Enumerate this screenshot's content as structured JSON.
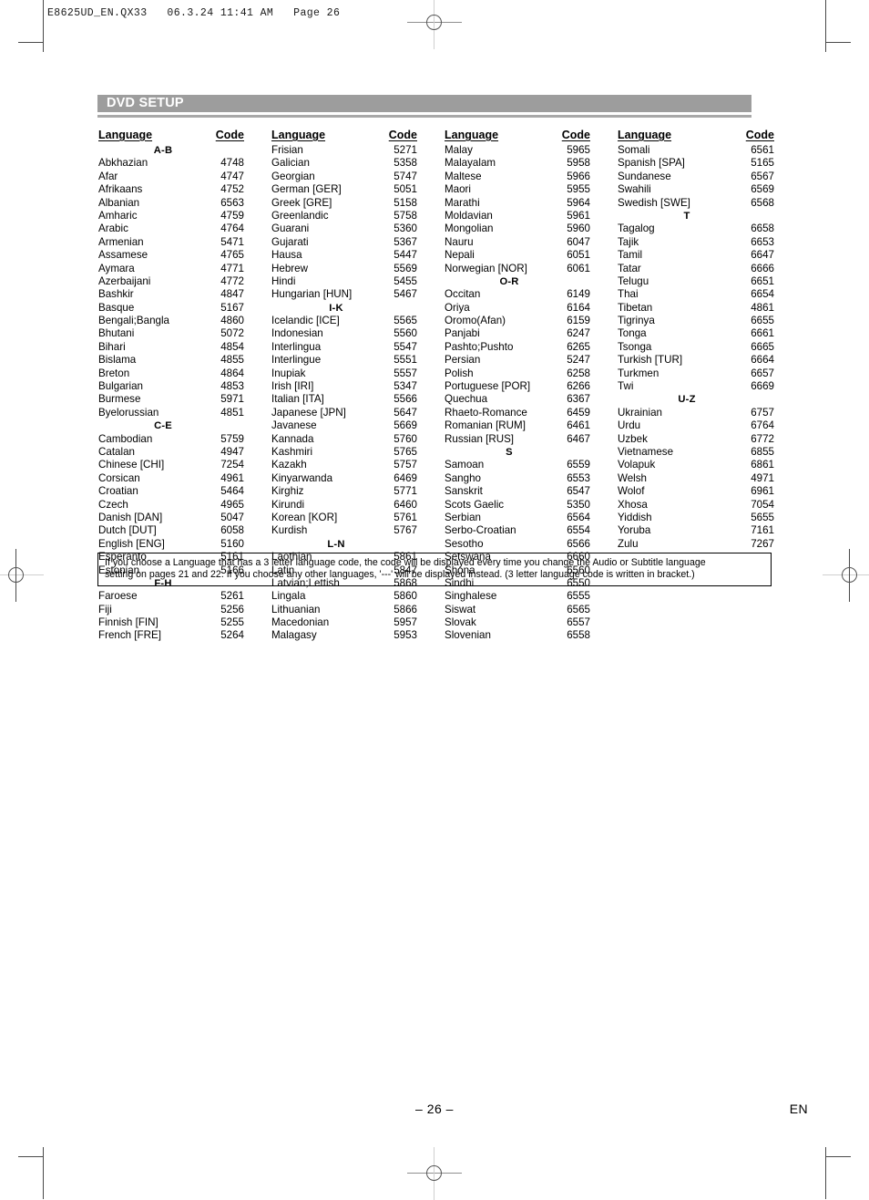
{
  "file_header": "E8625UD_EN.QX33   06.3.24 11:41 AM   Page 26",
  "section": {
    "title": "DVD SETUP",
    "bar_color": "#9d9d9d"
  },
  "table": {
    "header_language": "Language",
    "header_code": "Code",
    "columns": [
      {
        "id": "column-1",
        "rows": [
          {
            "type": "group",
            "label": "A-B"
          },
          {
            "type": "entry",
            "name": "Abkhazian",
            "code": "4748"
          },
          {
            "type": "entry",
            "name": "Afar",
            "code": "4747"
          },
          {
            "type": "entry",
            "name": "Afrikaans",
            "code": "4752"
          },
          {
            "type": "entry",
            "name": "Albanian",
            "code": "6563"
          },
          {
            "type": "entry",
            "name": "Amharic",
            "code": "4759"
          },
          {
            "type": "entry",
            "name": "Arabic",
            "code": "4764"
          },
          {
            "type": "entry",
            "name": "Armenian",
            "code": "5471"
          },
          {
            "type": "entry",
            "name": "Assamese",
            "code": "4765"
          },
          {
            "type": "entry",
            "name": "Aymara",
            "code": "4771"
          },
          {
            "type": "entry",
            "name": "Azerbaijani",
            "code": "4772"
          },
          {
            "type": "entry",
            "name": "Bashkir",
            "code": "4847"
          },
          {
            "type": "entry",
            "name": "Basque",
            "code": "5167"
          },
          {
            "type": "entry",
            "name": "Bengali;Bangla",
            "code": "4860"
          },
          {
            "type": "entry",
            "name": "Bhutani",
            "code": "5072"
          },
          {
            "type": "entry",
            "name": "Bihari",
            "code": "4854"
          },
          {
            "type": "entry",
            "name": "Bislama",
            "code": "4855"
          },
          {
            "type": "entry",
            "name": "Breton",
            "code": "4864"
          },
          {
            "type": "entry",
            "name": "Bulgarian",
            "code": "4853"
          },
          {
            "type": "entry",
            "name": "Burmese",
            "code": "5971"
          },
          {
            "type": "entry",
            "name": "Byelorussian",
            "code": "4851"
          },
          {
            "type": "group",
            "label": "C-E"
          },
          {
            "type": "entry",
            "name": "Cambodian",
            "code": "5759"
          },
          {
            "type": "entry",
            "name": "Catalan",
            "code": "4947"
          },
          {
            "type": "entry",
            "name": "Chinese [CHI]",
            "code": "7254"
          },
          {
            "type": "entry",
            "name": "Corsican",
            "code": "4961"
          },
          {
            "type": "entry",
            "name": "Croatian",
            "code": "5464"
          },
          {
            "type": "entry",
            "name": "Czech",
            "code": "4965"
          },
          {
            "type": "entry",
            "name": "Danish [DAN]",
            "code": "5047"
          },
          {
            "type": "entry",
            "name": "Dutch [DUT]",
            "code": "6058"
          },
          {
            "type": "entry",
            "name": "English [ENG]",
            "code": "5160"
          },
          {
            "type": "entry",
            "name": "Esperanto",
            "code": "5161"
          },
          {
            "type": "entry",
            "name": "Estonian",
            "code": "5166"
          },
          {
            "type": "group",
            "label": "F-H"
          },
          {
            "type": "entry",
            "name": "Faroese",
            "code": "5261"
          },
          {
            "type": "entry",
            "name": "Fiji",
            "code": "5256"
          },
          {
            "type": "entry",
            "name": "Finnish [FIN]",
            "code": "5255"
          },
          {
            "type": "entry",
            "name": "French [FRE]",
            "code": "5264"
          }
        ]
      },
      {
        "id": "column-2",
        "rows": [
          {
            "type": "entry",
            "name": "Frisian",
            "code": "5271"
          },
          {
            "type": "entry",
            "name": "Galician",
            "code": "5358"
          },
          {
            "type": "entry",
            "name": "Georgian",
            "code": "5747"
          },
          {
            "type": "entry",
            "name": "German [GER]",
            "code": "5051"
          },
          {
            "type": "entry",
            "name": "Greek [GRE]",
            "code": "5158"
          },
          {
            "type": "entry",
            "name": "Greenlandic",
            "code": "5758"
          },
          {
            "type": "entry",
            "name": "Guarani",
            "code": "5360"
          },
          {
            "type": "entry",
            "name": "Gujarati",
            "code": "5367"
          },
          {
            "type": "entry",
            "name": "Hausa",
            "code": "5447"
          },
          {
            "type": "entry",
            "name": "Hebrew",
            "code": "5569"
          },
          {
            "type": "entry",
            "name": "Hindi",
            "code": "5455"
          },
          {
            "type": "entry",
            "name": "Hungarian [HUN]",
            "code": "5467"
          },
          {
            "type": "group",
            "label": "I-K"
          },
          {
            "type": "entry",
            "name": "Icelandic [ICE]",
            "code": "5565"
          },
          {
            "type": "entry",
            "name": "Indonesian",
            "code": "5560"
          },
          {
            "type": "entry",
            "name": "Interlingua",
            "code": "5547"
          },
          {
            "type": "entry",
            "name": "Interlingue",
            "code": "5551"
          },
          {
            "type": "entry",
            "name": "Inupiak",
            "code": "5557"
          },
          {
            "type": "entry",
            "name": "Irish [IRI]",
            "code": "5347"
          },
          {
            "type": "entry",
            "name": "Italian [ITA]",
            "code": "5566"
          },
          {
            "type": "entry",
            "name": "Japanese [JPN]",
            "code": "5647"
          },
          {
            "type": "entry",
            "name": "Javanese",
            "code": "5669"
          },
          {
            "type": "entry",
            "name": "Kannada",
            "code": "5760"
          },
          {
            "type": "entry",
            "name": "Kashmiri",
            "code": "5765"
          },
          {
            "type": "entry",
            "name": "Kazakh",
            "code": "5757"
          },
          {
            "type": "entry",
            "name": "Kinyarwanda",
            "code": "6469"
          },
          {
            "type": "entry",
            "name": "Kirghiz",
            "code": "5771"
          },
          {
            "type": "entry",
            "name": "Kirundi",
            "code": "6460"
          },
          {
            "type": "entry",
            "name": "Korean [KOR]",
            "code": "5761"
          },
          {
            "type": "entry",
            "name": "Kurdish",
            "code": "5767"
          },
          {
            "type": "group",
            "label": "L-N"
          },
          {
            "type": "entry",
            "name": "Laothian",
            "code": "5861"
          },
          {
            "type": "entry",
            "name": "Latin",
            "code": "5847"
          },
          {
            "type": "entry",
            "name": "Latvian;Lettish",
            "code": "5868"
          },
          {
            "type": "entry",
            "name": "Lingala",
            "code": "5860"
          },
          {
            "type": "entry",
            "name": "Lithuanian",
            "code": "5866"
          },
          {
            "type": "entry",
            "name": "Macedonian",
            "code": "5957"
          },
          {
            "type": "entry",
            "name": "Malagasy",
            "code": "5953"
          }
        ]
      },
      {
        "id": "column-3",
        "rows": [
          {
            "type": "entry",
            "name": "Malay",
            "code": "5965"
          },
          {
            "type": "entry",
            "name": "Malayalam",
            "code": "5958"
          },
          {
            "type": "entry",
            "name": "Maltese",
            "code": "5966"
          },
          {
            "type": "entry",
            "name": "Maori",
            "code": "5955"
          },
          {
            "type": "entry",
            "name": "Marathi",
            "code": "5964"
          },
          {
            "type": "entry",
            "name": "Moldavian",
            "code": "5961"
          },
          {
            "type": "entry",
            "name": "Mongolian",
            "code": "5960"
          },
          {
            "type": "entry",
            "name": "Nauru",
            "code": "6047"
          },
          {
            "type": "entry",
            "name": "Nepali",
            "code": "6051"
          },
          {
            "type": "entry",
            "name": "Norwegian [NOR]",
            "code": "6061"
          },
          {
            "type": "group",
            "label": "O-R"
          },
          {
            "type": "entry",
            "name": "Occitan",
            "code": "6149"
          },
          {
            "type": "entry",
            "name": "Oriya",
            "code": "6164"
          },
          {
            "type": "entry",
            "name": "Oromo(Afan)",
            "code": "6159"
          },
          {
            "type": "entry",
            "name": "Panjabi",
            "code": "6247"
          },
          {
            "type": "entry",
            "name": "Pashto;Pushto",
            "code": "6265"
          },
          {
            "type": "entry",
            "name": "Persian",
            "code": "5247"
          },
          {
            "type": "entry",
            "name": "Polish",
            "code": "6258"
          },
          {
            "type": "entry",
            "name": "Portuguese [POR]",
            "code": "6266"
          },
          {
            "type": "entry",
            "name": "Quechua",
            "code": "6367"
          },
          {
            "type": "entry",
            "name": "Rhaeto-Romance",
            "code": "6459"
          },
          {
            "type": "entry",
            "name": "Romanian [RUM]",
            "code": "6461"
          },
          {
            "type": "entry",
            "name": "Russian [RUS]",
            "code": "6467"
          },
          {
            "type": "group",
            "label": "S"
          },
          {
            "type": "entry",
            "name": "Samoan",
            "code": "6559"
          },
          {
            "type": "entry",
            "name": "Sangho",
            "code": "6553"
          },
          {
            "type": "entry",
            "name": "Sanskrit",
            "code": "6547"
          },
          {
            "type": "entry",
            "name": "Scots Gaelic",
            "code": "5350"
          },
          {
            "type": "entry",
            "name": "Serbian",
            "code": "6564"
          },
          {
            "type": "entry",
            "name": "Serbo-Croatian",
            "code": "6554"
          },
          {
            "type": "entry",
            "name": "Sesotho",
            "code": "6566"
          },
          {
            "type": "entry",
            "name": "Setswana",
            "code": "6660"
          },
          {
            "type": "entry",
            "name": "Shona",
            "code": "6560"
          },
          {
            "type": "entry",
            "name": "Sindhi",
            "code": "6550"
          },
          {
            "type": "entry",
            "name": "Singhalese",
            "code": "6555"
          },
          {
            "type": "entry",
            "name": "Siswat",
            "code": "6565"
          },
          {
            "type": "entry",
            "name": "Slovak",
            "code": "6557"
          },
          {
            "type": "entry",
            "name": "Slovenian",
            "code": "6558"
          }
        ]
      },
      {
        "id": "column-4",
        "rows": [
          {
            "type": "entry",
            "name": "Somali",
            "code": "6561"
          },
          {
            "type": "entry",
            "name": "Spanish [SPA]",
            "code": "5165"
          },
          {
            "type": "entry",
            "name": "Sundanese",
            "code": "6567"
          },
          {
            "type": "entry",
            "name": "Swahili",
            "code": "6569"
          },
          {
            "type": "entry",
            "name": "Swedish [SWE]",
            "code": "6568"
          },
          {
            "type": "group",
            "label": "T"
          },
          {
            "type": "entry",
            "name": "Tagalog",
            "code": "6658"
          },
          {
            "type": "entry",
            "name": "Tajik",
            "code": "6653"
          },
          {
            "type": "entry",
            "name": "Tamil",
            "code": "6647"
          },
          {
            "type": "entry",
            "name": "Tatar",
            "code": "6666"
          },
          {
            "type": "entry",
            "name": "Telugu",
            "code": "6651"
          },
          {
            "type": "entry",
            "name": "Thai",
            "code": "6654"
          },
          {
            "type": "entry",
            "name": "Tibetan",
            "code": "4861"
          },
          {
            "type": "entry",
            "name": "Tigrinya",
            "code": "6655"
          },
          {
            "type": "entry",
            "name": "Tonga",
            "code": "6661"
          },
          {
            "type": "entry",
            "name": "Tsonga",
            "code": "6665"
          },
          {
            "type": "entry",
            "name": "Turkish [TUR]",
            "code": "6664"
          },
          {
            "type": "entry",
            "name": "Turkmen",
            "code": "6657"
          },
          {
            "type": "entry",
            "name": "Twi",
            "code": "6669"
          },
          {
            "type": "group",
            "label": "U-Z"
          },
          {
            "type": "entry",
            "name": "Ukrainian",
            "code": "6757"
          },
          {
            "type": "entry",
            "name": "Urdu",
            "code": "6764"
          },
          {
            "type": "entry",
            "name": "Uzbek",
            "code": "6772"
          },
          {
            "type": "entry",
            "name": "Vietnamese",
            "code": "6855"
          },
          {
            "type": "entry",
            "name": "Volapuk",
            "code": "6861"
          },
          {
            "type": "entry",
            "name": "Welsh",
            "code": "4971"
          },
          {
            "type": "entry",
            "name": "Wolof",
            "code": "6961"
          },
          {
            "type": "entry",
            "name": "Xhosa",
            "code": "7054"
          },
          {
            "type": "entry",
            "name": "Yiddish",
            "code": "5655"
          },
          {
            "type": "entry",
            "name": "Yoruba",
            "code": "7161"
          },
          {
            "type": "entry",
            "name": "Zulu",
            "code": "7267"
          }
        ]
      }
    ]
  },
  "note": {
    "line1": "If you choose a Language that has a 3 letter language code, the code will be displayed every time you change the Audio or Subtitle language",
    "line2": "setting on pages 21 and 22. If you choose any other languages, '---' will be displayed instead. (3 letter language code is written in bracket.)"
  },
  "footer": {
    "page_number": "– 26 –",
    "language_code": "EN"
  }
}
